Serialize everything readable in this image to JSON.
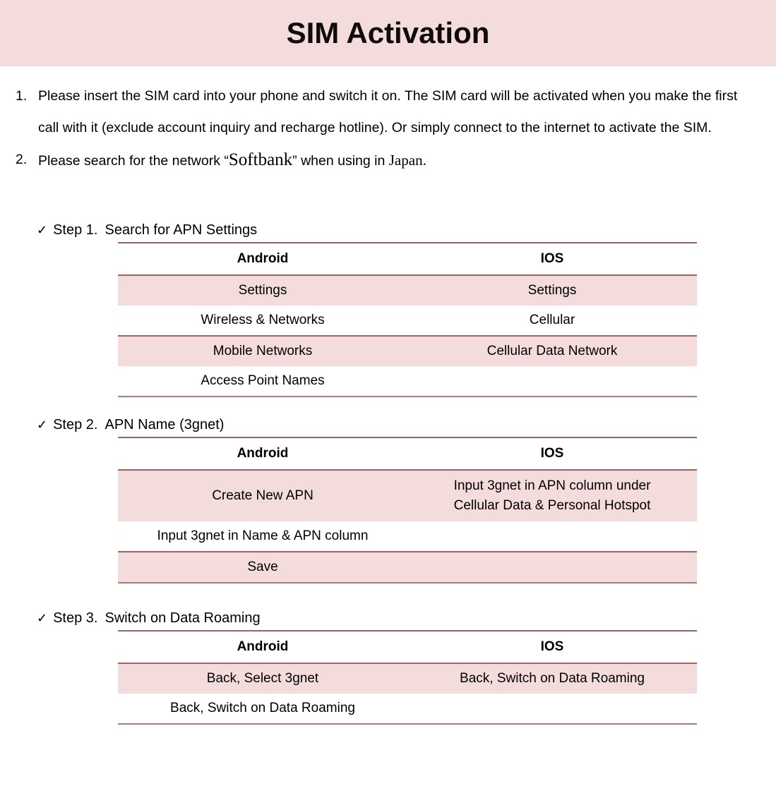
{
  "header": {
    "title": "SIM Activation"
  },
  "intro": {
    "items": [
      {
        "num": "1.",
        "text": "Please insert the SIM card into your phone and switch it on. The SIM card will be activated when you make the first call with it (exclude account inquiry and recharge hotline). Or simply connect to the internet to activate the SIM."
      },
      {
        "num": "2.",
        "prefix": "Please search for the network “",
        "network": "Softbank",
        "middle": "” when using in ",
        "country": "Japan",
        "suffix": "."
      }
    ]
  },
  "steps": [
    {
      "check": "✓",
      "label": "Step 1.",
      "desc": "Search for APN Settings",
      "columns": [
        "Android",
        "IOS"
      ],
      "rows": [
        {
          "android": "Settings",
          "ios": "Settings",
          "shaded": true
        },
        {
          "android": "Wireless & Networks",
          "ios": "Cellular",
          "shaded": false
        },
        {
          "android": "Mobile Networks",
          "ios": "Cellular Data Network",
          "shaded": true
        },
        {
          "android": "Access Point Names",
          "ios": "",
          "shaded": false,
          "merged": true
        }
      ]
    },
    {
      "check": "✓",
      "label": "Step 2.",
      "desc": "APN Name (3gnet)",
      "columns": [
        "Android",
        "IOS"
      ],
      "rows": [
        {
          "android": "Create New APN",
          "ios_line1": "Input 3gnet in APN column under",
          "ios_line2": "Cellular Data & Personal Hotspot",
          "shaded": true,
          "tall": true
        },
        {
          "android": "Input 3gnet in Name & APN column",
          "ios": "",
          "shaded": false,
          "merged": true
        },
        {
          "android": "Save",
          "ios": "",
          "shaded": true,
          "merged": true
        }
      ]
    },
    {
      "check": "✓",
      "label": "Step 3.",
      "desc": "Switch on Data Roaming",
      "columns": [
        "Android",
        "IOS"
      ],
      "rows": [
        {
          "android": "Back, Select 3gnet",
          "ios": "Back, Switch on Data Roaming",
          "shaded": true
        },
        {
          "android": "Back, Switch on Data Roaming",
          "ios": "",
          "shaded": false,
          "merged": true
        }
      ]
    }
  ],
  "colors": {
    "banner_bg": "#f4dcdc",
    "row_shade": "#f4dcdc",
    "rule": "#9e6264",
    "text": "#000000"
  }
}
